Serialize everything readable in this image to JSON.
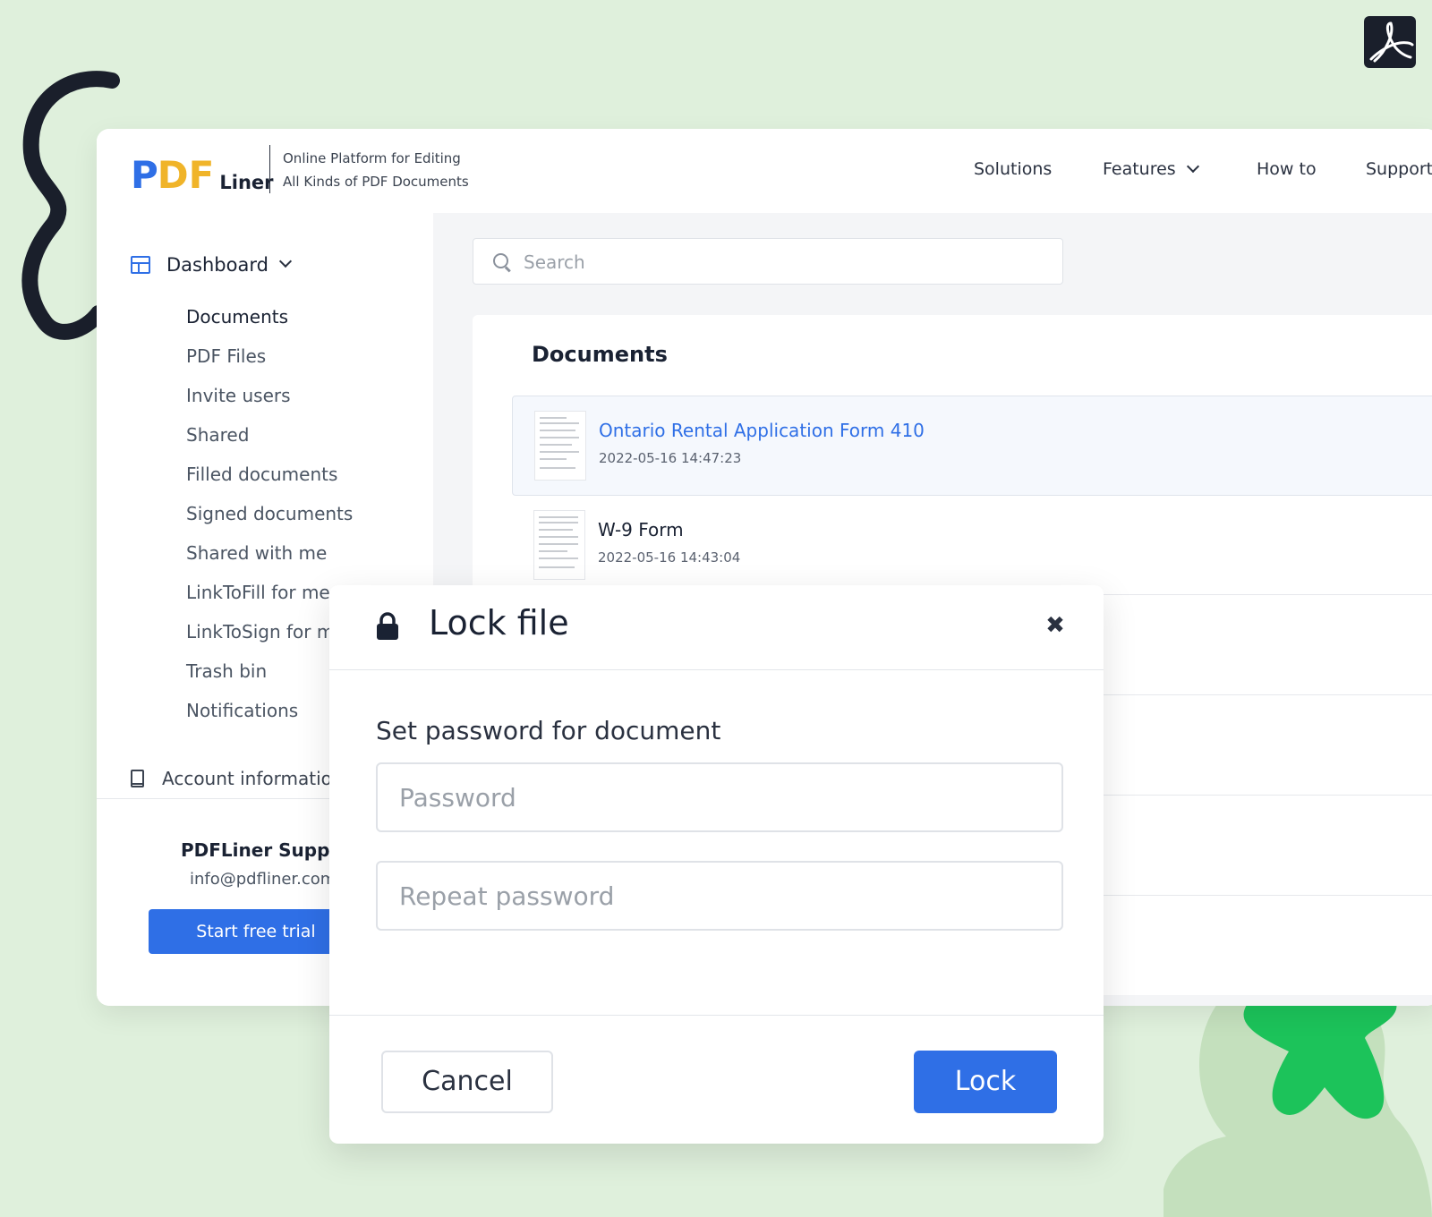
{
  "brand": {
    "logo_pdf_p": "P",
    "logo_pdf_df": "DF",
    "logo_liner": "Liner",
    "tagline_line1": "Online Platform for Editing",
    "tagline_line2": "All Kinds of PDF Documents"
  },
  "nav": {
    "solutions": "Solutions",
    "features": "Features",
    "how_to": "How to",
    "support": "Support"
  },
  "sidebar": {
    "dashboard_label": "Dashboard",
    "items": [
      {
        "label": "Documents",
        "active": true
      },
      {
        "label": "PDF Files"
      },
      {
        "label": "Invite users"
      },
      {
        "label": "Shared"
      },
      {
        "label": "Filled documents"
      },
      {
        "label": "Signed documents"
      },
      {
        "label": "Shared with me"
      },
      {
        "label": "LinkToFill for me"
      },
      {
        "label": "LinkToSign for me"
      },
      {
        "label": "Trash bin"
      },
      {
        "label": "Notifications"
      }
    ],
    "account_label": "Account information",
    "support_title": "PDFLiner Support",
    "support_email": "info@pdfliner.com",
    "trial_button": "Start free trial"
  },
  "main": {
    "search_placeholder": "Search",
    "section_title": "Documents",
    "documents": [
      {
        "name": "Ontario Rental Application Form 410",
        "date": "2022-05-16 14:47:23",
        "selected": true
      },
      {
        "name": "W-9 Form",
        "date": "2022-05-16 14:43:04",
        "selected": false
      }
    ]
  },
  "modal": {
    "title": "Lock file",
    "close_glyph": "✖",
    "label": "Set password for document",
    "password_placeholder": "Password",
    "repeat_placeholder": "Repeat password",
    "cancel": "Cancel",
    "lock": "Lock"
  },
  "colors": {
    "accent": "#2f6fe6",
    "brand_yellow": "#f0b429",
    "background": "#dff0dc",
    "star_green": "#1cc35a"
  }
}
